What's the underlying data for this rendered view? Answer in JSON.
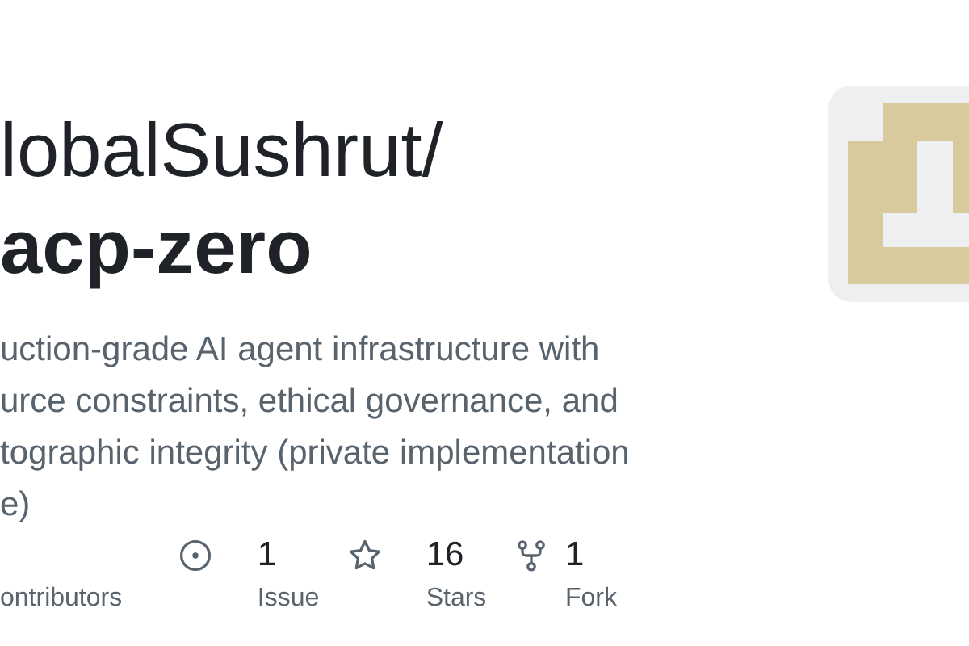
{
  "repo": {
    "owner": "lobalSushrut/",
    "name": "acp-zero"
  },
  "description_lines": [
    "uction-grade AI agent infrastructure with",
    "urce constraints, ethical governance, and",
    "tographic integrity (private implementation",
    "e)"
  ],
  "stats": [
    {
      "kind": "contributors",
      "label": "ontributors"
    },
    {
      "kind": "issue",
      "count": "1",
      "label": "Issue"
    },
    {
      "kind": "stars",
      "count": "16",
      "label": "Stars"
    },
    {
      "kind": "fork",
      "count": "1",
      "label": "Fork"
    }
  ]
}
